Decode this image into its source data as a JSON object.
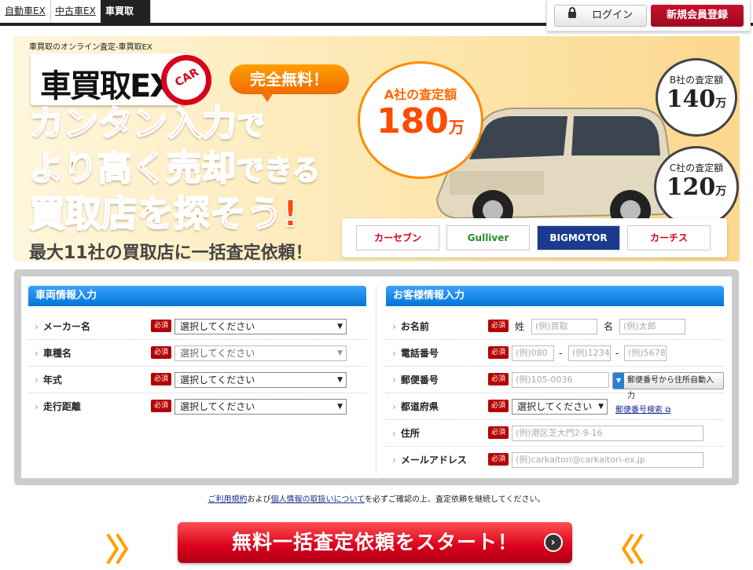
{
  "topnav": {
    "tabs": [
      "自動車EX",
      "中古車EX",
      "車買取EX"
    ],
    "active_index": 2
  },
  "auth": {
    "login_label": "ログイン",
    "register_label": "新規会員登録"
  },
  "hero": {
    "tagline": "車買取のオンライン査定-車買取EX",
    "logo_text": "車買取EX",
    "logo_ring": "CAR",
    "free_badge": "完全無料！",
    "headline": {
      "l1_main": "カンタン入力",
      "l1_suffix": "で",
      "l2_main": "より高く売却",
      "l2_suffix": "できる",
      "l3": "買取店を探そう!"
    },
    "subhead": {
      "em": "最大11社",
      "rest": "の買取店に一括査定依頼！"
    },
    "quotes": [
      {
        "name": "A社の査定額",
        "value": "180",
        "unit": "万"
      },
      {
        "name": "B社の査定額",
        "value": "140",
        "unit": "万"
      },
      {
        "name": "C社の査定額",
        "value": "120",
        "unit": "万"
      }
    ],
    "partners": [
      "カーセブン",
      "Gulliver",
      "BIGMOTOR",
      "カーチス"
    ]
  },
  "form": {
    "vehicle": {
      "title": "車両情報入力",
      "required_label": "必須",
      "rows": [
        {
          "label": "メーカー名",
          "value": "選択してください"
        },
        {
          "label": "車種名",
          "value": "選択してください"
        },
        {
          "label": "年式",
          "value": "選択してください"
        },
        {
          "label": "走行距離",
          "value": "選択してください"
        }
      ]
    },
    "customer": {
      "title": "お客様情報入力",
      "name": {
        "label": "お名前",
        "last_label": "姓",
        "last_placeholder": "(例)買取",
        "first_label": "名",
        "first_placeholder": "(例)太郎"
      },
      "phone": {
        "label": "電話番号",
        "p1": "(例)080",
        "p2": "(例)1234",
        "p3": "(例)5678",
        "sep": "-"
      },
      "zip": {
        "label": "郵便番号",
        "placeholder": "(例)105-0036",
        "button": "郵便番号から住所自動入力"
      },
      "pref": {
        "label": "都道府県",
        "value": "選択してください",
        "search_link": "郵便番号検索"
      },
      "address": {
        "label": "住所",
        "placeholder": "(例)港区芝大門2-9-16"
      },
      "email": {
        "label": "メールアドレス",
        "placeholder": "(例)carkaitori@carkaitori-ex.jp"
      }
    }
  },
  "notice": {
    "link1": "ご利用規約",
    "mid": "および",
    "link2": "個人情報の取扱いについて",
    "rest": "を必ずご確認の上、査定依頼を継続してください。"
  },
  "cta": {
    "label": "無料一括査定依頼をスタート！",
    "chev_left": "〉〉",
    "chev_right": "〈〈"
  },
  "colors": {
    "accent": "#d9001b",
    "form_blue": "#0075d6",
    "orange": "#ff6a00"
  }
}
